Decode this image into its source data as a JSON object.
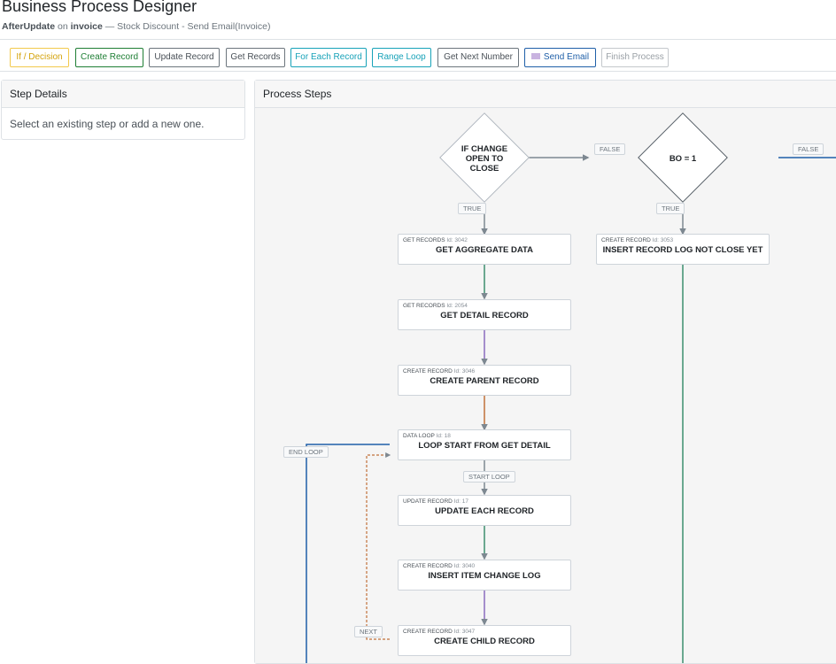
{
  "header": {
    "title": "Business Process Designer",
    "trigger": "AfterUpdate",
    "on_word": " on ",
    "table": "invoice",
    "process_name": " — Stock Discount - Send Email(Invoice)"
  },
  "toolbar": {
    "if_decision": "If / Decision",
    "create_record": "Create Record",
    "update_record": "Update Record",
    "get_records": "Get Records",
    "for_each_record": "For Each Record",
    "range_loop": "Range Loop",
    "get_next_number": "Get Next Number",
    "send_email": "Send Email",
    "finish_process": "Finish Process",
    "colors": {
      "if_decision": "#e6b800",
      "create_record": "#1e7e34",
      "neutral": "#495057",
      "loop": "#17a2b8",
      "send_email": "#1f5fa8",
      "disabled": "#9aa0a6"
    }
  },
  "step_details": {
    "title": "Step Details",
    "message": "Select an existing step or add a new one."
  },
  "process_steps": {
    "title": "Process Steps",
    "decisions": [
      {
        "text_l1": "IF CHANGE",
        "text_l2": "OPEN TO",
        "text_l3": "CLOSE"
      },
      {
        "text_l1": "BO = 1"
      }
    ],
    "labels": {
      "true": "TRUE",
      "false": "FALSE",
      "end_loop": "END LOOP",
      "start_loop": "START LOOP",
      "next": "NEXT"
    },
    "steps": [
      {
        "type": "GET RECORDS",
        "id": "Id: 3042",
        "name": "GET AGGREGATE DATA"
      },
      {
        "type": "GET RECORDS",
        "id": "Id: 2054",
        "name": "GET DETAIL RECORD"
      },
      {
        "type": "CREATE RECORD",
        "id": "Id: 3046",
        "name": "CREATE PARENT RECORD"
      },
      {
        "type": "DATA LOOP",
        "id": "Id: 18",
        "name": "LOOP START FROM GET DETAIL"
      },
      {
        "type": "UPDATE RECORD",
        "id": "Id: 17",
        "name": "UPDATE EACH RECORD"
      },
      {
        "type": "CREATE RECORD",
        "id": "Id: 3040",
        "name": "INSERT ITEM CHANGE LOG"
      },
      {
        "type": "CREATE RECORD",
        "id": "Id: 3047",
        "name": "CREATE CHILD RECORD"
      },
      {
        "type": "CREATE RECORD",
        "id": "Id: 3053",
        "name": "INSERT RECORD LOG NOT CLOSE YET"
      }
    ]
  }
}
